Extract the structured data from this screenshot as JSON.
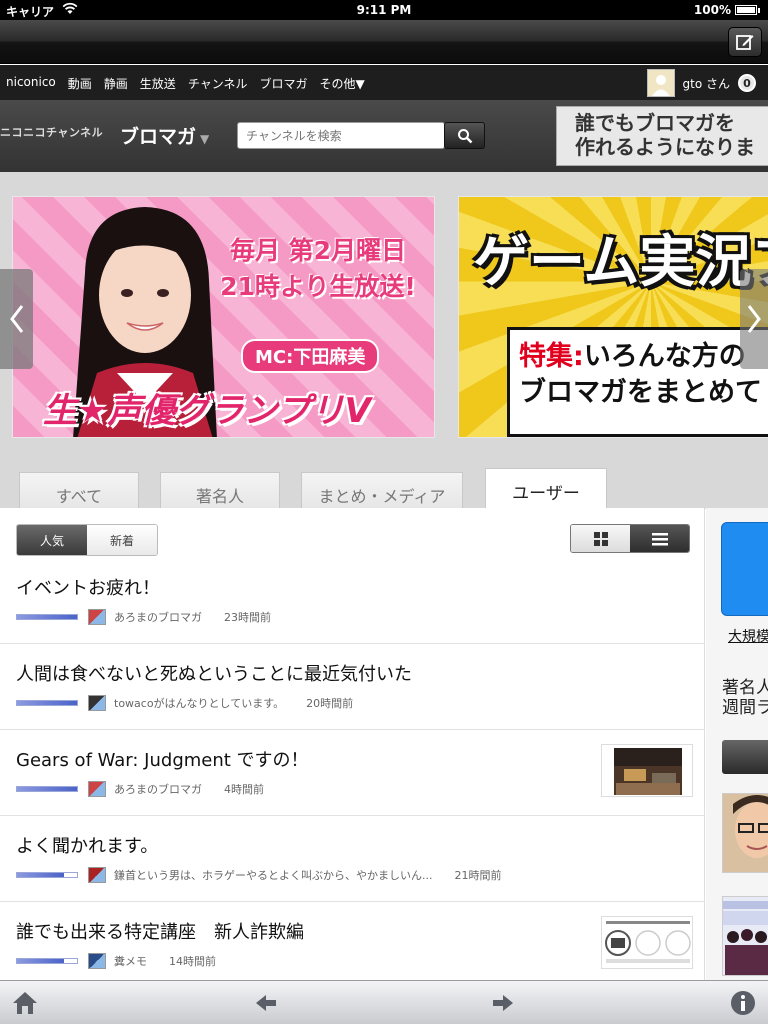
{
  "status": {
    "carrier": "キャリア",
    "time": "9:11 PM",
    "battery": "100%"
  },
  "nav": {
    "links": [
      "niconico",
      "動画",
      "静画",
      "生放送",
      "チャンネル",
      "ブロマガ",
      "その他▼"
    ],
    "user_name": "gto さん",
    "notification_count": "0"
  },
  "header": {
    "brand": "ニコニコチャンネル",
    "section": "ブロマガ",
    "search_placeholder": "チャンネルを検索",
    "promo_line1": "誰でもブロマガを",
    "promo_line2": "作れるようになりま"
  },
  "banners": {
    "b1_line1": "毎月 第2月曜日",
    "b1_line2": "21時より生放送!",
    "b1_mc": "MC:下田麻美",
    "b1_logo": "生★声優グランプリV",
    "b2_title": "ゲーム実況ブ",
    "b2_tag": "特集:",
    "b2_line1": "いろんな方の",
    "b2_line2": "ブロマガをまとめて"
  },
  "tabs": [
    "すべて",
    "著名人",
    "まとめ・メディア",
    "ユーザー"
  ],
  "sort": {
    "popular": "人気",
    "new": "新着"
  },
  "articles": [
    {
      "title": "イベントお疲れ！",
      "channel": "あろまのブロマガ",
      "time": "23時間前",
      "popularity": 1.0,
      "thumb": false,
      "icon": "#c44"
    },
    {
      "title": "人間は食べないと死ぬということに最近気付いた",
      "channel": "towacoがはんなりとしています。",
      "time": "20時間前",
      "popularity": 1.0,
      "thumb": false,
      "icon": "#333"
    },
    {
      "title": "Gears of War: Judgment ですの！",
      "channel": "あろまのブロマガ",
      "time": "4時間前",
      "popularity": 1.0,
      "thumb": true,
      "icon": "#c44"
    },
    {
      "title": "よく聞かれます。",
      "channel": "鎌首という男は、ホラゲーやるとよく叫ぶから、やかましいん...",
      "time": "21時間前",
      "popularity": 0.78,
      "thumb": false,
      "icon": "#a22"
    },
    {
      "title": "誰でも出来る特定講座　新人詐欺編",
      "channel": "糞メモ",
      "time": "14時間前",
      "popularity": 0.78,
      "thumb": true,
      "icon": "#2a4d8a"
    }
  ],
  "sidebar": {
    "link": "大規模",
    "header_line1": "著名人",
    "header_line2": "週間ラ"
  }
}
